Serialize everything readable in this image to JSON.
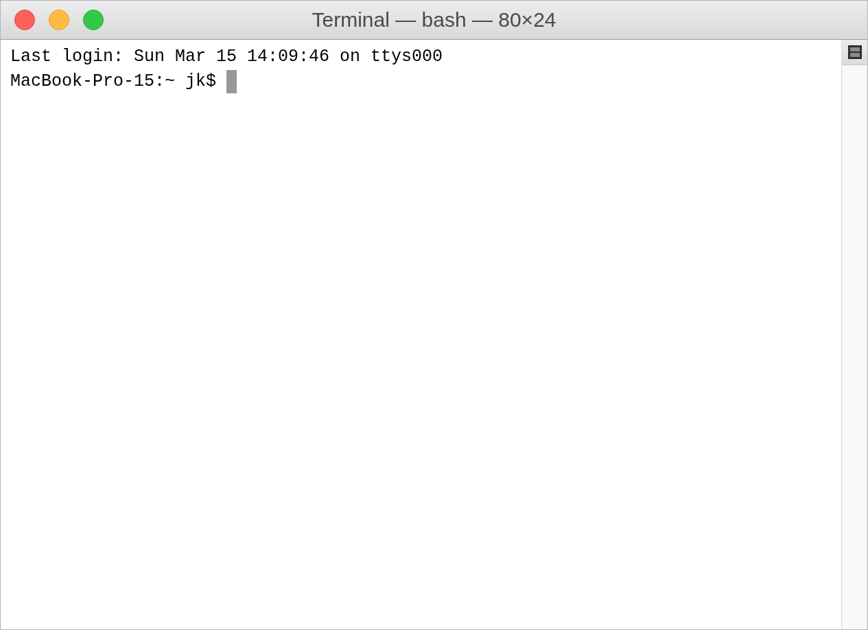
{
  "window": {
    "title": "Terminal — bash — 80×24"
  },
  "terminal": {
    "lines": [
      {
        "text": "Last login: Sun Mar 15 14:09:46 on ttys000",
        "cursor": false
      },
      {
        "text": "MacBook-Pro-15:~ jk$",
        "cursor": true
      }
    ]
  }
}
